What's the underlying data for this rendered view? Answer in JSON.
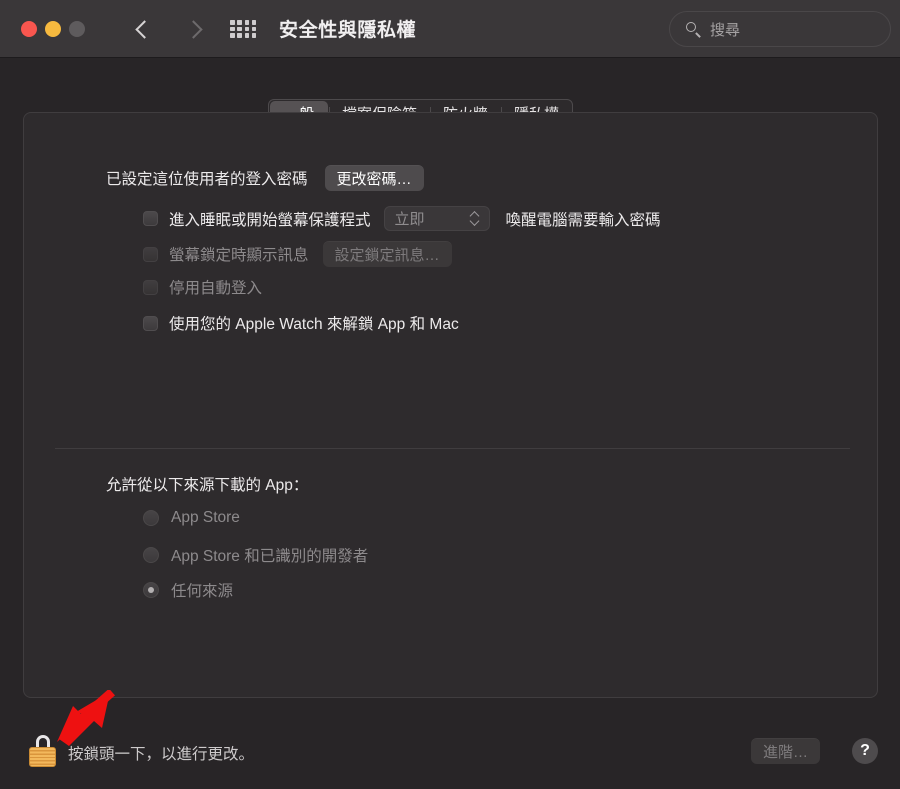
{
  "window": {
    "title": "安全性與隱私權",
    "traffic_lights": [
      "close-red",
      "minimize-yellow",
      "zoom-disabled"
    ],
    "back_icon": "chevron-left-icon",
    "forward_icon": "chevron-right-icon",
    "grid_icon": "show-all-grid-icon"
  },
  "search": {
    "icon": "search-icon",
    "placeholder": "搜尋",
    "value": ""
  },
  "tabs": [
    {
      "label": "一般",
      "selected": true
    },
    {
      "label": "檔案保險箱",
      "selected": false
    },
    {
      "label": "防火牆",
      "selected": false
    },
    {
      "label": "隱私權",
      "selected": false
    }
  ],
  "general": {
    "password_label": "已設定這位使用者的登入密碼",
    "change_password_button": "更改密碼…",
    "require_password": {
      "label": "進入睡眠或開始螢幕保護程式",
      "checked": false,
      "delay_value": "立即",
      "suffix": "喚醒電腦需要輸入密碼"
    },
    "lock_message": {
      "label": "螢幕鎖定時顯示訊息",
      "checked": false,
      "button": "設定鎖定訊息…"
    },
    "disable_auto_login": {
      "label": "停用自動登入",
      "checked": false
    },
    "apple_watch": {
      "label": "使用您的 Apple Watch 來解鎖 App 和 Mac",
      "checked": false
    }
  },
  "download_sources": {
    "heading": "允許從以下來源下載的 App：",
    "options": [
      {
        "label": "App Store",
        "selected": false
      },
      {
        "label": "App Store 和已識別的開發者",
        "selected": false
      },
      {
        "label": "任何來源",
        "selected": true
      }
    ]
  },
  "footer": {
    "lock_icon": "padlock-locked-icon",
    "lock_hint": "按鎖頭一下，以進行更改。",
    "advanced_button": "進階…",
    "help_button": "?"
  },
  "annotation": {
    "arrow_icon": "red-arrow-pointing-to-lock",
    "color": "#ee1111"
  }
}
